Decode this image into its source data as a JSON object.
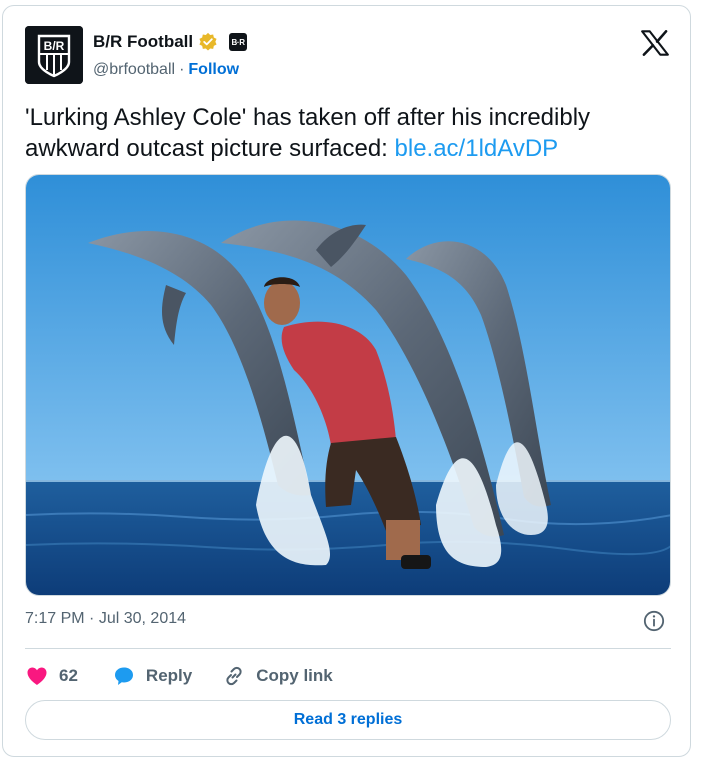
{
  "author": {
    "display_name": "B/R Football",
    "handle": "@brfootball",
    "separator": "·",
    "follow_label": "Follow",
    "avatar_text": "B/R",
    "affiliate_badge_text": "B·R"
  },
  "tweet": {
    "text": "'Lurking Ashley Cole' has taken off after his incredibly awkward outcast picture surfaced: ",
    "link": "ble.ac/1ldAvDP",
    "time": "7:17 PM",
    "date": "Jul 30, 2014",
    "meta_separator": "·"
  },
  "actions": {
    "like_count": "62",
    "reply_label": "Reply",
    "copy_label": "Copy link"
  },
  "footer": {
    "read_replies_label": "Read 3 replies"
  },
  "colors": {
    "like": "#f91880",
    "reply": "#1d9bf0",
    "link": "#1d9bf0",
    "follow": "#006fd6",
    "verified": "#e8b829"
  }
}
